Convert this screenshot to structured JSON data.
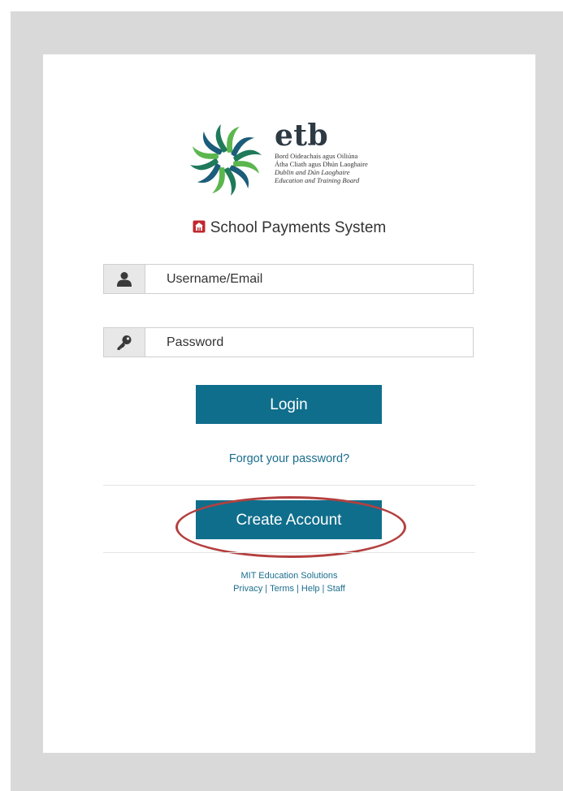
{
  "logo": {
    "brand": "etb",
    "line1": "Bord Oideachais agus Oiliúna",
    "line2": "Átha Cliath agus Dhún Laoghaire",
    "line3": "Dublin and Dún Laoghaire",
    "line4": "Education and Training Board",
    "colors": [
      "#1f7a5a",
      "#5bb64e",
      "#1b5d7a"
    ]
  },
  "system_title": "School Payments System",
  "username": {
    "placeholder": "Username/Email",
    "icon": "user-icon"
  },
  "password": {
    "placeholder": "Password",
    "icon": "key-icon"
  },
  "login_label": "Login",
  "forgot_label": "Forgot your password?",
  "create_account_label": "Create Account",
  "footer": {
    "company": "MIT Education Solutions",
    "links": [
      "Privacy",
      "Terms",
      "Help",
      "Staff"
    ],
    "separator": "|"
  },
  "colors": {
    "accent": "#0f6e8c",
    "link": "#1a6e8d",
    "highlight": "#b3403f",
    "frame": "#d9d9d9"
  }
}
